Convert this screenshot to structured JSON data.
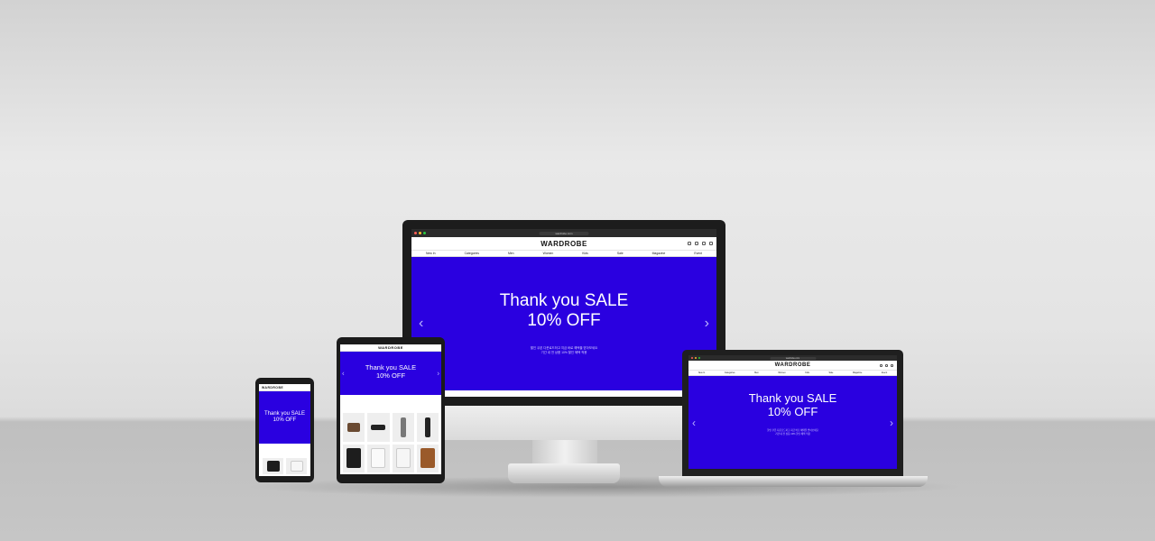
{
  "site": {
    "logo": "WARDROBE",
    "url": "wardrobe.com"
  },
  "nav": [
    "New In",
    "Categories",
    "Men",
    "Women",
    "Kids",
    "Sale",
    "Magazine",
    "Event"
  ],
  "hero": {
    "line1": "Thank you SALE",
    "line2": "10% OFF",
    "note1": "할인 쿠폰 다운로드하고 지금 바로 혜택을 받아보세요",
    "note2": "기간 내 전 상품 10% 할인 혜택 적용"
  },
  "colors": {
    "hero_bg": "#2a00e0",
    "bezel": "#1c1c1c"
  },
  "icons": [
    "search-icon",
    "user-icon",
    "heart-icon",
    "bag-icon",
    "chevron-left-icon",
    "chevron-right-icon"
  ]
}
